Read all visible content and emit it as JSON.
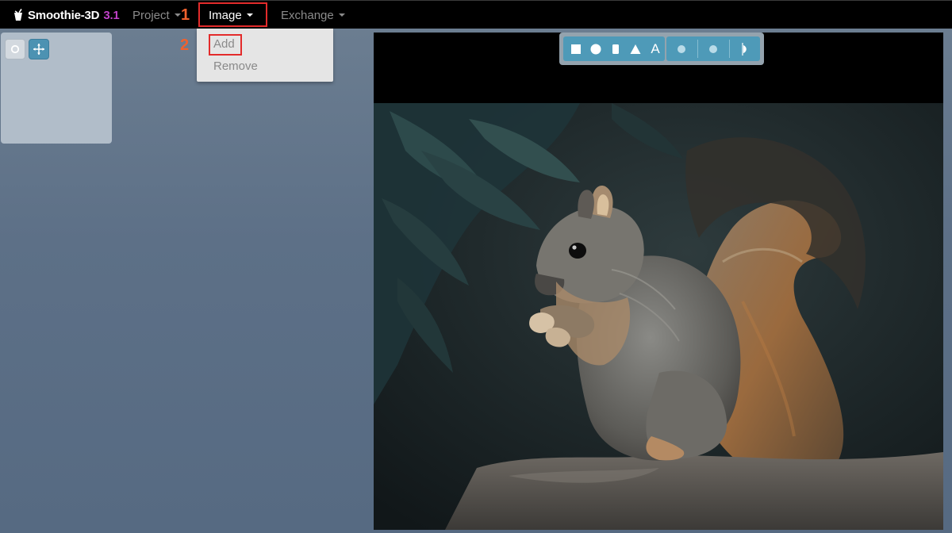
{
  "navbar": {
    "brand": {
      "name": "Smoothie-3D",
      "version": "3.1",
      "logo_icon": "smoothie-cup-icon"
    },
    "menus": [
      {
        "label": "Project"
      },
      {
        "label": "Image"
      },
      {
        "label": "Exchange"
      }
    ]
  },
  "dropdown": {
    "items": [
      {
        "label": "Add"
      },
      {
        "label": "Remove"
      }
    ]
  },
  "annotations": {
    "step1": "1",
    "step2": "2",
    "highlight_color": "#e32b2b",
    "step_color": "#f0612d"
  },
  "tool_panel": {
    "tools": [
      {
        "icon": "rotate-icon"
      },
      {
        "icon": "move-arrows-icon"
      }
    ]
  },
  "shape_toolbar": {
    "tools": [
      {
        "icon": "square-icon"
      },
      {
        "icon": "circle-icon"
      },
      {
        "icon": "rounded-rect-icon"
      },
      {
        "icon": "triangle-icon"
      },
      {
        "icon": "text-icon",
        "label": "A"
      },
      {
        "icon": "sphere-icon"
      },
      {
        "icon": "disc-icon"
      },
      {
        "icon": "half-disc-icon"
      }
    ]
  },
  "canvas": {
    "image_subject_icon": "squirrel-photo"
  },
  "colors": {
    "navbar_bg": "#000000",
    "brand_version": "#c041c8",
    "toolbar_blue": "#4e9ab8",
    "background": "#5d7087"
  }
}
